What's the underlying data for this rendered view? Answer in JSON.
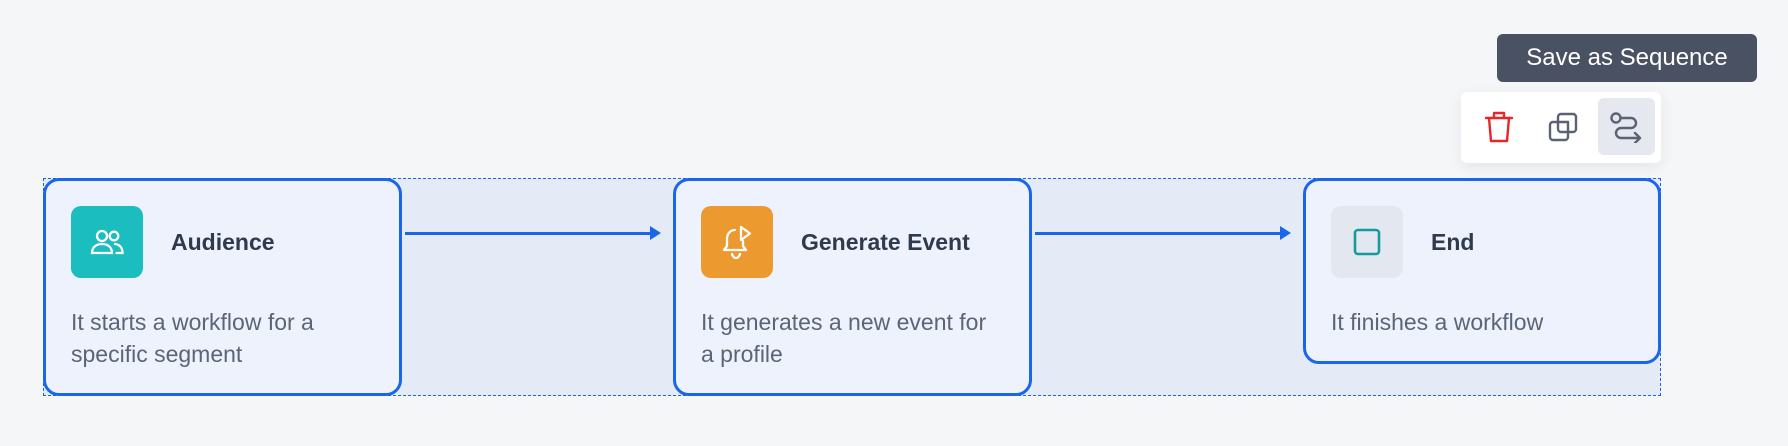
{
  "tooltip": {
    "text": "Save as Sequence"
  },
  "toolbar": {
    "delete_icon": "trash-icon",
    "duplicate_icon": "duplicate-icon",
    "sequence_icon": "route-icon"
  },
  "nodes": [
    {
      "title": "Audience",
      "description": "It starts a workflow for a specific segment",
      "icon": "users-icon",
      "icon_bg": "#1bbdbf"
    },
    {
      "title": "Generate Event",
      "description": "It generates a new event for a profile",
      "icon": "bell-play-icon",
      "icon_bg": "#ec9a30"
    },
    {
      "title": "End",
      "description": "It finishes a workflow",
      "icon": "stop-square-icon",
      "icon_bg": "#e3e7ef"
    }
  ],
  "colors": {
    "accent": "#1a66ea",
    "background": "#f5f6f8",
    "danger": "#e5262a"
  }
}
